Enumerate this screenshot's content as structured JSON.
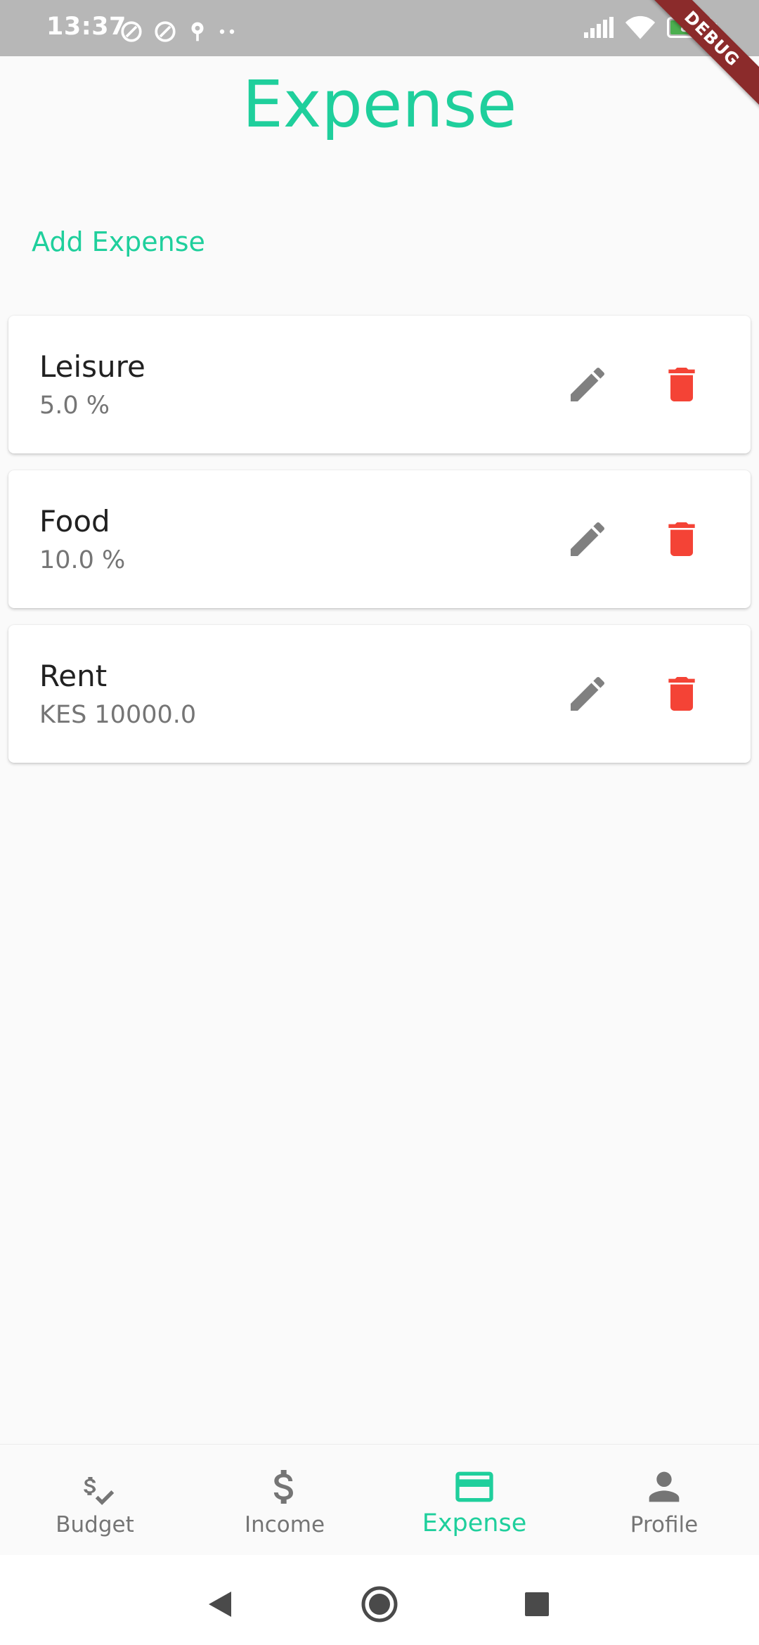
{
  "status_bar": {
    "time": "13:37",
    "battery_level": "84",
    "battery_fraction": 0.84
  },
  "debug_banner": "DEBUG",
  "page": {
    "title": "Expense",
    "add_label": "Add Expense"
  },
  "expenses": [
    {
      "name": "Leisure",
      "value": "5.0 %"
    },
    {
      "name": "Food",
      "value": "10.0 %"
    },
    {
      "name": "Rent",
      "value": "KES 10000.0"
    }
  ],
  "bottom_nav": [
    {
      "label": "Budget",
      "icon": "budget-icon",
      "active": false
    },
    {
      "label": "Income",
      "icon": "dollar-icon",
      "active": false
    },
    {
      "label": "Expense",
      "icon": "credit-card-icon",
      "active": true
    },
    {
      "label": "Profile",
      "icon": "person-icon",
      "active": false
    }
  ],
  "colors": {
    "accent": "#1fcf9c",
    "delete": "#f44336",
    "edit": "#808080",
    "nav_inactive": "#757575"
  }
}
